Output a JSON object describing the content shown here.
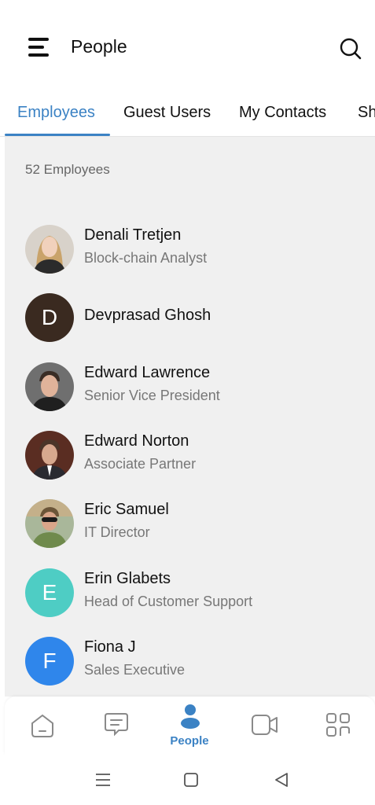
{
  "header": {
    "title": "People",
    "menu_icon": "hamburger-menu-icon",
    "search_icon": "search-icon"
  },
  "tabs": [
    {
      "label": "Employees",
      "active": true
    },
    {
      "label": "Guest Users",
      "active": false
    },
    {
      "label": "My Contacts",
      "active": false
    },
    {
      "label": "Sh",
      "active": false
    }
  ],
  "employees_count": "52 Employees",
  "employees": [
    {
      "name": "Denali Tretjen",
      "role": "Block-chain Analyst",
      "avatar": "photo"
    },
    {
      "name": "Devprasad Ghosh",
      "role": "",
      "avatar": "letter",
      "initial": "D",
      "color": "#3a2a20"
    },
    {
      "name": "Edward Lawrence",
      "role": "Senior Vice President",
      "avatar": "photo"
    },
    {
      "name": "Edward Norton",
      "role": "Associate Partner",
      "avatar": "photo"
    },
    {
      "name": "Eric Samuel",
      "role": "IT Director",
      "avatar": "photo"
    },
    {
      "name": "Erin Glabets",
      "role": "Head of Customer Support",
      "avatar": "letter",
      "initial": "E",
      "color": "#4ecdc4"
    },
    {
      "name": "Fiona J",
      "role": "Sales Executive",
      "avatar": "letter",
      "initial": "F",
      "color": "#2f86eb"
    }
  ],
  "bottom_nav": [
    {
      "icon": "home-icon",
      "label": ""
    },
    {
      "icon": "chat-icon",
      "label": ""
    },
    {
      "icon": "person-icon",
      "label": "People",
      "active": true
    },
    {
      "icon": "video-call-icon",
      "label": ""
    },
    {
      "icon": "apps-grid-icon",
      "label": ""
    }
  ],
  "system_nav": [
    "recent-apps-icon",
    "home-square-icon",
    "back-triangle-icon"
  ],
  "colors": {
    "accent": "#3b82c4",
    "list_bg": "#f0f0f0"
  }
}
